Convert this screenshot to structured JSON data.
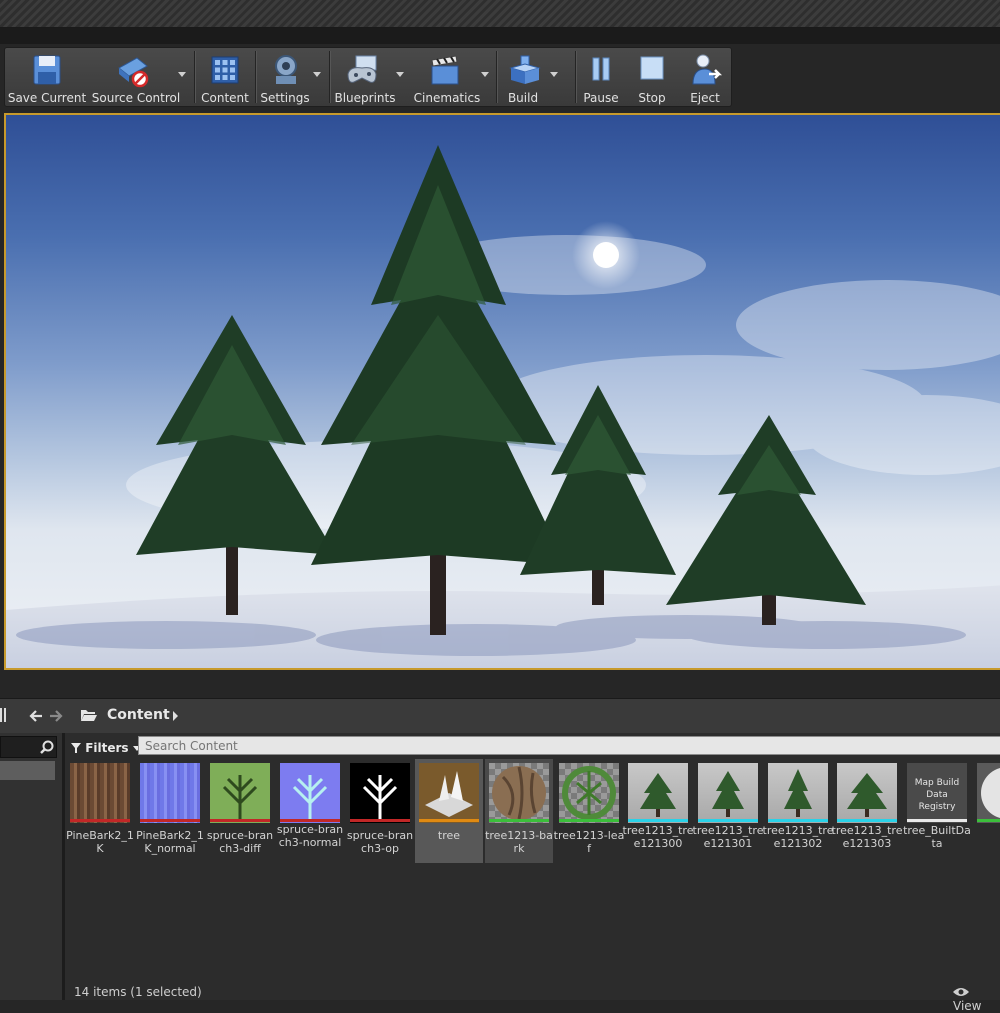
{
  "toolbar": {
    "buttons": [
      {
        "label": "Save Current"
      },
      {
        "label": "Source Control"
      },
      {
        "label": "Content"
      },
      {
        "label": "Settings"
      },
      {
        "label": "Blueprints"
      },
      {
        "label": "Cinematics"
      },
      {
        "label": "Build"
      },
      {
        "label": "Pause"
      },
      {
        "label": "Stop"
      },
      {
        "label": "Eject"
      }
    ]
  },
  "content_browser": {
    "breadcrumb": "Content",
    "filters_label": "Filters",
    "search_placeholder": "Search Content",
    "assets": [
      {
        "label": "PineBark2_1K",
        "bar_color": "#c22727"
      },
      {
        "label": "PineBark2_1K_normal",
        "bar_color": "#c22727"
      },
      {
        "label": "spruce-branch3-diff",
        "bar_color": "#c22727"
      },
      {
        "label": "spruce-branch3-normal",
        "bar_color": "#c22727"
      },
      {
        "label": "spruce-branch3-op",
        "bar_color": "#c22727"
      },
      {
        "label": "tree",
        "bar_color": "#e08a12"
      },
      {
        "label": "tree1213-bark",
        "bar_color": "#3bbf3b"
      },
      {
        "label": "tree1213-leaf",
        "bar_color": "#3bbf3b"
      },
      {
        "label": "tree1213_tree121300",
        "bar_color": "#29d2e8"
      },
      {
        "label": "tree1213_tree121301",
        "bar_color": "#29d2e8"
      },
      {
        "label": "tree1213_tree121302",
        "bar_color": "#29d2e8"
      },
      {
        "label": "tree1213_tree121303",
        "bar_color": "#29d2e8"
      },
      {
        "label": "tree_BuiltData",
        "bar_color": "#e8e8e8",
        "thumb_text": "Map Build Data Registry"
      }
    ],
    "status": "14 items (1 selected)",
    "view_options_label": "View"
  },
  "colors": {
    "viewport_border": "#c79a2c",
    "selection_bg": "#585858"
  }
}
